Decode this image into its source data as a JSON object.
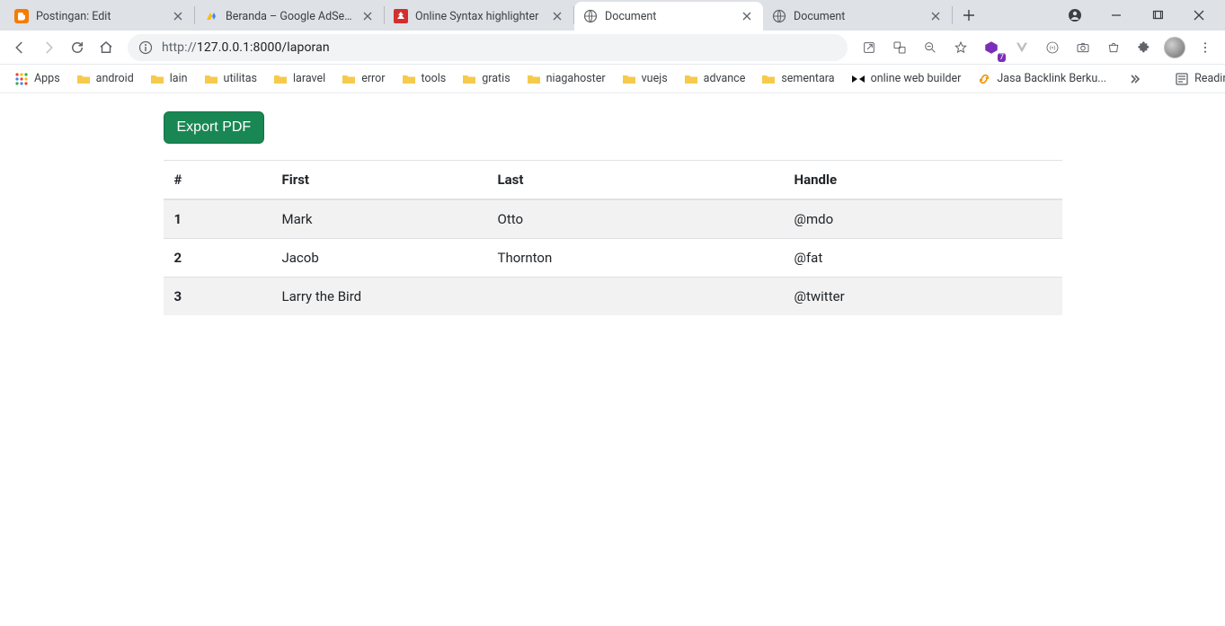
{
  "tabs": [
    {
      "title": "Postingan: Edit",
      "favicon": "blogger",
      "active": false
    },
    {
      "title": "Beranda – Google AdSense",
      "favicon": "adsense",
      "active": false
    },
    {
      "title": "Online Syntax highlighter",
      "favicon": "tree",
      "active": false
    },
    {
      "title": "Document",
      "favicon": "globe",
      "active": true
    },
    {
      "title": "Document",
      "favicon": "globe",
      "active": false
    }
  ],
  "window_controls": {
    "account_icon": "account"
  },
  "toolbar": {
    "url_scheme": "http://",
    "url_rest": "127.0.0.1:8000/laporan",
    "extension_badge": "7"
  },
  "bookmarks": {
    "apps_label": "Apps",
    "items": [
      {
        "label": "android",
        "type": "folder"
      },
      {
        "label": "lain",
        "type": "folder"
      },
      {
        "label": "utilitas",
        "type": "folder"
      },
      {
        "label": "laravel",
        "type": "folder"
      },
      {
        "label": "error",
        "type": "folder"
      },
      {
        "label": "tools",
        "type": "folder"
      },
      {
        "label": "gratis",
        "type": "folder"
      },
      {
        "label": "niagahoster",
        "type": "folder"
      },
      {
        "label": "vuejs",
        "type": "folder"
      },
      {
        "label": "advance",
        "type": "folder"
      },
      {
        "label": "sementara",
        "type": "folder"
      },
      {
        "label": "online web builder",
        "type": "bowtie"
      },
      {
        "label": "Jasa Backlink Berku...",
        "type": "link"
      }
    ],
    "reading_list_label": "Reading list"
  },
  "page": {
    "export_label": "Export PDF",
    "columns": [
      "#",
      "First",
      "Last",
      "Handle"
    ],
    "rows": [
      {
        "num": "1",
        "first": "Mark",
        "last": "Otto",
        "handle": "@mdo"
      },
      {
        "num": "2",
        "first": "Jacob",
        "last": "Thornton",
        "handle": "@fat"
      },
      {
        "num": "3",
        "first": "Larry the Bird",
        "last": "",
        "handle": "@twitter"
      }
    ]
  }
}
